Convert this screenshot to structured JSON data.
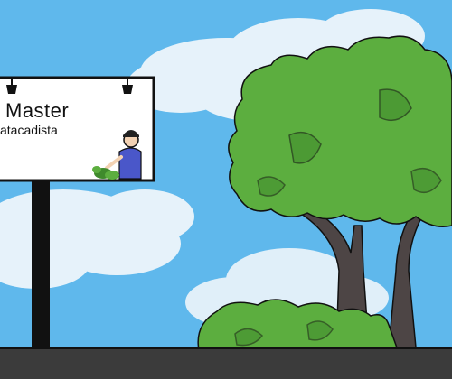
{
  "billboard": {
    "title": "Master",
    "subtitle": "atacadista"
  },
  "colors": {
    "sky": "#5fb8ec",
    "cloud": "#eef6fb",
    "foliage": "#5cae3f",
    "foliage_dark": "#3f8a2c",
    "trunk": "#4d4545",
    "ground": "#3b3b3b",
    "billboard_face": "#ffffff",
    "person_shirt": "#4a57c9"
  },
  "icons": [
    "lamp-icon",
    "person-icon",
    "plant-icon"
  ]
}
